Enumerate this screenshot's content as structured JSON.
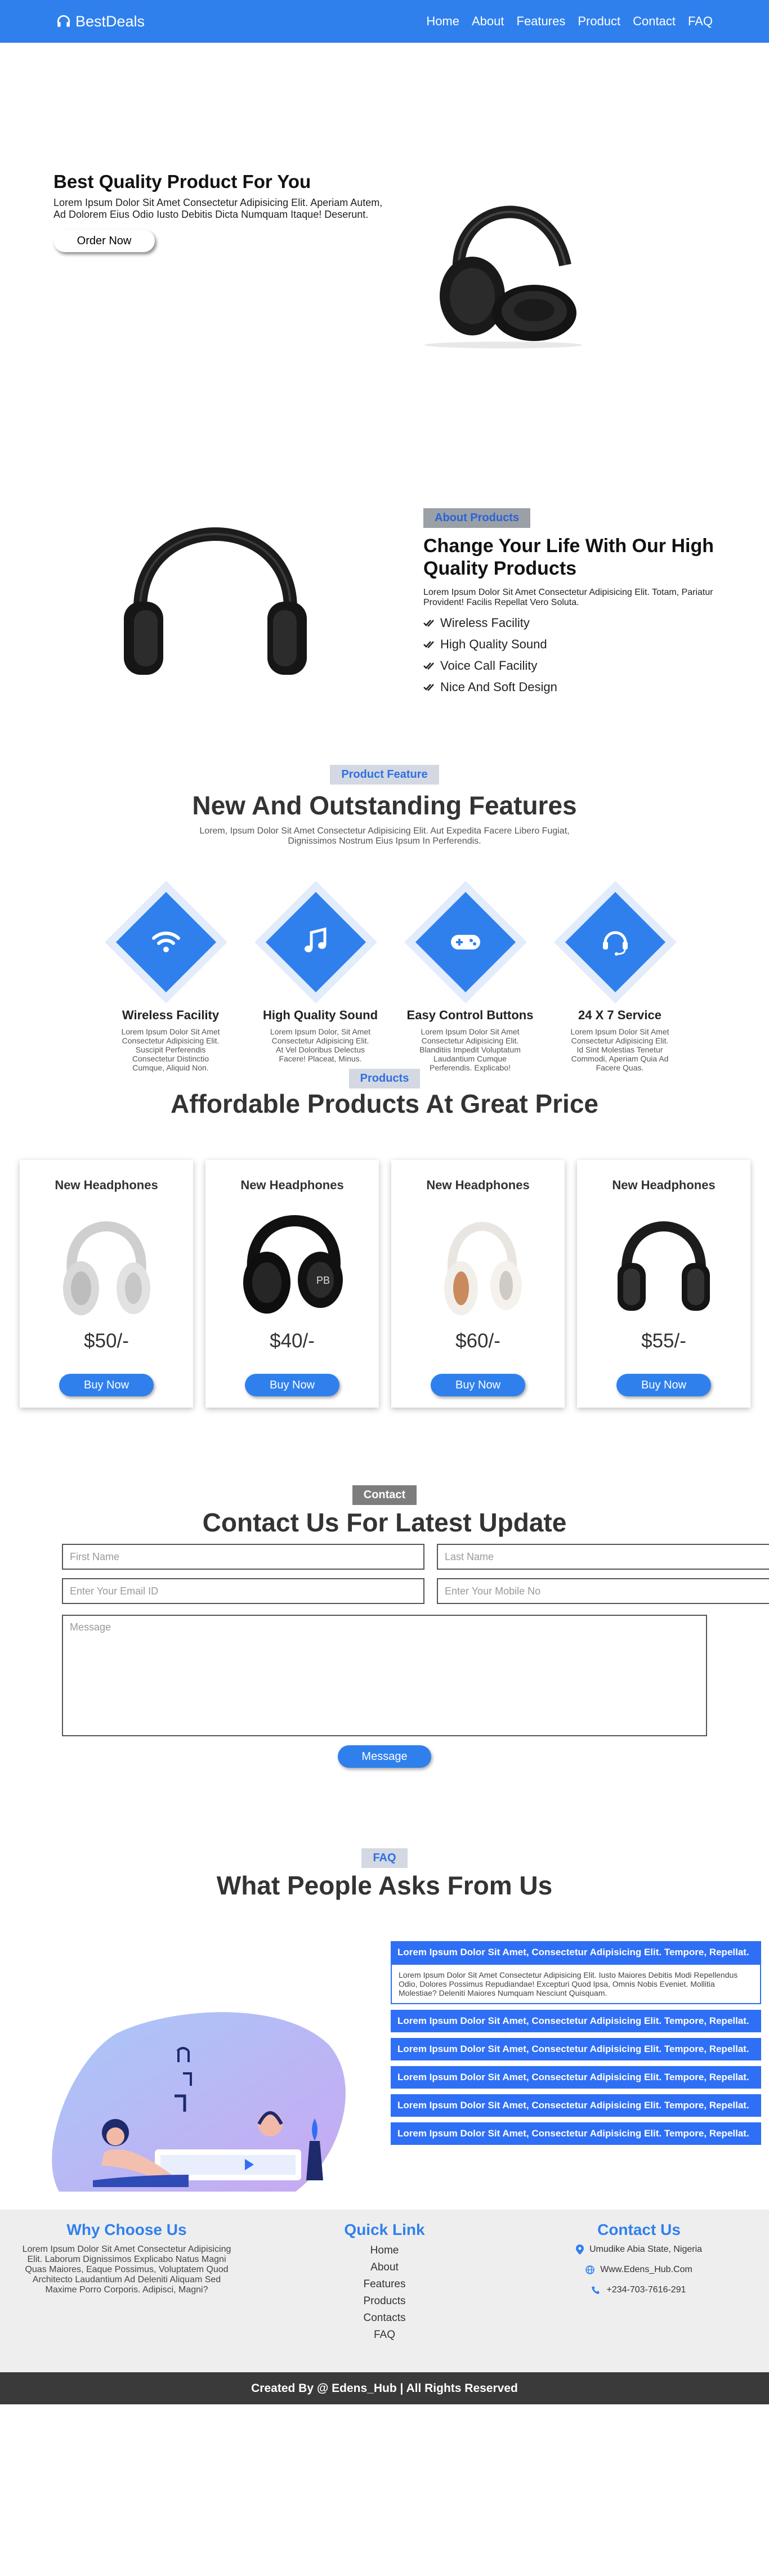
{
  "nav": {
    "brand": "BestDeals",
    "links": [
      "Home",
      "About",
      "Features",
      "Product",
      "Contact",
      "FAQ"
    ]
  },
  "hero": {
    "title": "Best Quality Product For You",
    "text": "Lorem Ipsum Dolor Sit Amet Consectetur Adipisicing Elit. Aperiam Autem, Ad Dolorem Eius Odio Iusto Debitis Dicta Numquam Itaque! Deserunt.",
    "button": "Order Now"
  },
  "about": {
    "tag": "About Products",
    "title": "Change Your Life With Our High Quality Products",
    "text": "Lorem Ipsum Dolor Sit Amet Consectetur Adipisicing Elit. Totam, Pariatur Provident! Facilis Repellat Vero Soluta.",
    "items": [
      "Wireless Facility",
      "High Quality Sound",
      "Voice Call Facility",
      "Nice And Soft Design"
    ]
  },
  "features": {
    "tag": "Product Feature",
    "title": "New And Outstanding Features",
    "subtitle_line1": "Lorem, Ipsum Dolor Sit Amet Consectetur Adipisicing Elit. Aut Expedita Facere Libero Fugiat,",
    "subtitle_line2": "Dignissimos Nostrum Eius Ipsum In Perferendis.",
    "items": [
      {
        "title": "Wireless Facility",
        "text": "Lorem Ipsum Dolor Sit Amet Consectetur Adipisicing Elit. Suscipit Perferendis Consectetur Distinctio Cumque, Aliquid Non.",
        "icon": "wifi-icon"
      },
      {
        "title": "High Quality Sound",
        "text": "Lorem Ipsum Dolor, Sit Amet Consectetur Adipisicing Elit. At Vel Doloribus Delectus Facere! Placeat, Minus.",
        "icon": "music-note-icon"
      },
      {
        "title": "Easy Control Buttons",
        "text": "Lorem Ipsum Dolor Sit Amet Consectetur Adipisicing Elit. Blanditiis Impedit Voluptatum Laudantium Cumque Perferendis. Explicabo!",
        "icon": "gamepad-icon"
      },
      {
        "title": "24 X 7 Service",
        "text": "Lorem Ipsum Dolor Sit Amet Consectetur Adipisicing Elit. Id Sint Molestias Tenetur Commodi, Aperiam Quia Ad Facere Quas.",
        "icon": "headset-icon"
      }
    ]
  },
  "products": {
    "tag": "Products",
    "title": "Affordable Products At Great Price",
    "items": [
      {
        "name": "New Headphones",
        "price": "$50/-",
        "button": "Buy Now"
      },
      {
        "name": "New Headphones",
        "price": "$40/-",
        "button": "Buy Now"
      },
      {
        "name": "New Headphones",
        "price": "$60/-",
        "button": "Buy Now"
      },
      {
        "name": "New Headphones",
        "price": "$55/-",
        "button": "Buy Now"
      }
    ]
  },
  "contact": {
    "tag": "Contact",
    "title": "Contact Us For Latest Update",
    "first_name": "First Name",
    "last_name": "Last Name",
    "email": "Enter Your Email ID",
    "mobile": "Enter Your Mobile No",
    "message": "Message",
    "button": "Message"
  },
  "faq": {
    "tag": "FAQ",
    "title": "What People Asks From Us",
    "question": "Lorem Ipsum Dolor Sit Amet, Consectetur Adipisicing Elit. Tempore, Repellat.",
    "answer": "Lorem Ipsum Dolor Sit Amet Consectetur Adipisicing Elit. Iusto Maiores Debitis Modi Repellendus Odio, Dolores Possimus Repudiandae! Excepturi Quod Ipsa, Omnis Nobis Eveniet. Mollitia Molestiae? Deleniti Maiores Numquam Nesciunt Quisquam."
  },
  "footer": {
    "why_title": "Why Choose Us",
    "why_text": "Lorem Ipsum Dolor Sit Amet Consectetur Adipisicing Elit. Laborum Dignissimos Explicabo Natus Magni Quas Maiores, Eaque Possimus, Voluptatem Quod Architecto Laudantium Ad Deleniti Aliquam Sed Maxime Porro Corporis. Adipisci, Magni?",
    "quick_title": "Quick Link",
    "quick_links": [
      "Home",
      "About",
      "Features",
      "Products",
      "Contacts",
      "FAQ"
    ],
    "contact_title": "Contact Us",
    "address": "Umudike Abia State, Nigeria",
    "website": "Www.Edens_Hub.Com",
    "phone": "+234-703-7616-291",
    "copyright": "Created By @ Edens_Hub | All Rights Reserved"
  },
  "colors": {
    "primary": "#2f80ed",
    "faq_blue": "#2f6ff5",
    "footer_bg": "#eeeeee",
    "copyright_bg": "#3a3a3a"
  }
}
